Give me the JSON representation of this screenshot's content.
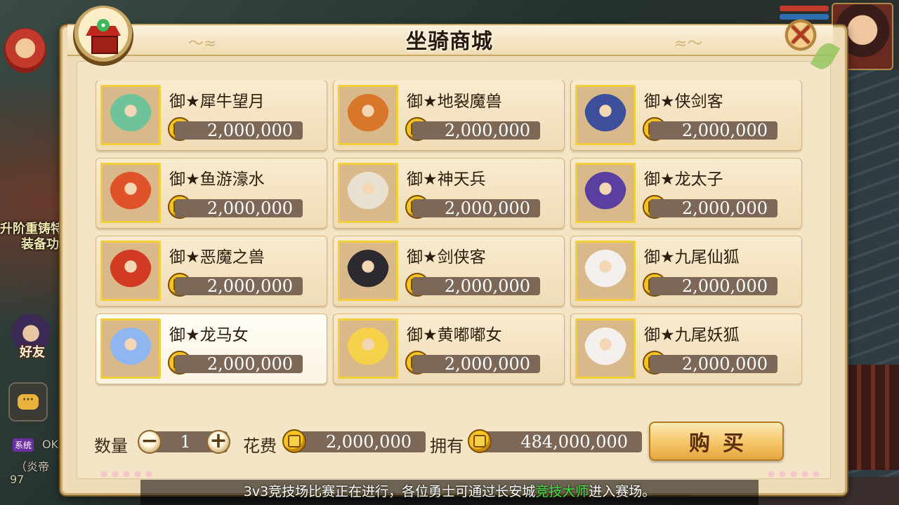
{
  "dialog": {
    "title": "坐骑商城"
  },
  "hud": {
    "side_text_1": "升阶重铸特",
    "side_text_2": "装备功",
    "friends_label": "好友",
    "chat_icon_text": "···",
    "system_tag": "系统",
    "system_partial": "OK",
    "side_small_1": "（炎帝",
    "side_small_2": "97"
  },
  "partial_top_row": [
    {
      "price": "2,000,000"
    },
    {
      "price": "2,000,000"
    },
    {
      "price": "2,000,000"
    }
  ],
  "mounts": [
    {
      "name": "御★犀牛望月",
      "price": "2,000,000",
      "color": "#6fc39a"
    },
    {
      "name": "御★地裂魔兽",
      "price": "2,000,000",
      "color": "#d8772a"
    },
    {
      "name": "御★侠剑客",
      "price": "2,000,000",
      "color": "#3d4e9a"
    },
    {
      "name": "御★鱼游濠水",
      "price": "2,000,000",
      "color": "#e0532a"
    },
    {
      "name": "御★神天兵",
      "price": "2,000,000",
      "color": "#e9e1d0"
    },
    {
      "name": "御★龙太子",
      "price": "2,000,000",
      "color": "#5a3fa0"
    },
    {
      "name": "御★恶魔之兽",
      "price": "2,000,000",
      "color": "#d33a24"
    },
    {
      "name": "御★剑侠客",
      "price": "2,000,000",
      "color": "#2c2a30"
    },
    {
      "name": "御★九尾仙狐",
      "price": "2,000,000",
      "color": "#f3f0ee"
    },
    {
      "name": "御★龙马女",
      "price": "2,000,000",
      "color": "#8fb6f0"
    },
    {
      "name": "御★黄嘟嘟女",
      "price": "2,000,000",
      "color": "#f5d24a"
    },
    {
      "name": "御★九尾妖狐",
      "price": "2,000,000",
      "color": "#f3f0ee"
    }
  ],
  "purchase": {
    "quantity_label": "数量",
    "quantity": "1",
    "minus": "−",
    "plus": "+",
    "cost_label": "花费",
    "cost": "2,000,000",
    "owned_label": "拥有",
    "owned": "484,000,000",
    "buy_label": "购买"
  },
  "marquee": {
    "before": "3v3竞技场比赛正在进行，各位勇士可通过长安城",
    "highlight": "竞技大师",
    "after": "进入赛场。"
  },
  "colors": {
    "coin": "#f5c422",
    "price_pill": "#7d6756",
    "thumb_border": "#f0cf3a",
    "highlight": "#3fe23f"
  }
}
